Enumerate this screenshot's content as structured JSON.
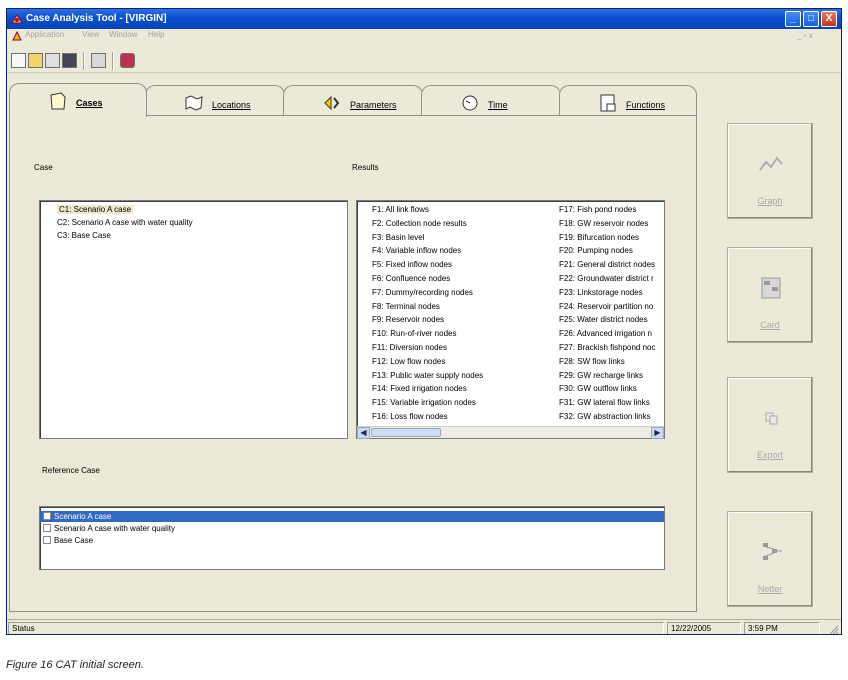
{
  "window": {
    "title": "Case Analysis Tool - [VIRGIN]",
    "minimize": "_",
    "maximize": "□",
    "close": "X",
    "mdi_controls": "_ ▫ x"
  },
  "menu": [
    "Application",
    "View",
    "Window",
    "Help"
  ],
  "toolbar": [
    "new-icon",
    "open-icon",
    "import-icon",
    "save-icon",
    "properties-icon",
    "book-icon"
  ],
  "tabs": [
    {
      "label": "Cases",
      "icon": "folder-icon"
    },
    {
      "label": "Locations",
      "icon": "map-icon"
    },
    {
      "label": "Parameters",
      "icon": "parameters-icon"
    },
    {
      "label": "Time",
      "icon": "clock-icon"
    },
    {
      "label": "Functions",
      "icon": "functions-icon"
    }
  ],
  "case": {
    "label": "Case",
    "items": [
      "C1: Scenario A case",
      "C2: Scenario A case with water quality",
      "C3: Base Case"
    ]
  },
  "results": {
    "label": "Results",
    "col1": [
      "F1: All link flows",
      "F2: Collection node results",
      "F3: Basin level",
      "F4: Variable inflow nodes",
      "F5: Fixed inflow nodes",
      "F6: Confluence nodes",
      "F7: Dummy/recording nodes",
      "F8: Terminal nodes",
      "F9: Reservoir nodes",
      "F10: Run-of-river nodes",
      "F11: Diversion nodes",
      "F12: Low flow nodes",
      "F13: Public water supply nodes",
      "F14: Fixed irrigation nodes",
      "F15: Variable irrigation nodes",
      "F16: Loss flow nodes"
    ],
    "col2": [
      "F17: Fish pond nodes",
      "F18: GW reservoir nodes",
      "F19: Bifurcation nodes",
      "F20: Pumping nodes",
      "F21: General district nodes",
      "F22: Groundwater district r",
      "F23: Linkstorage nodes",
      "F24: Reservoir partition no",
      "F25: Water district nodes",
      "F26: Advanced irrigation n",
      "F27: Brackish fishpond noc",
      "F28: SW flow links",
      "F29: GW recharge links",
      "F30: GW outflow links",
      "F31: GW lateral flow links",
      "F32: GW abstraction links"
    ]
  },
  "reference": {
    "label": "Reference Case",
    "items": [
      "Scenario A case",
      "Scenario A case with water quality",
      "Base Case"
    ]
  },
  "side_buttons": [
    {
      "label": "Graph",
      "icon": "graph-icon"
    },
    {
      "label": "Card",
      "icon": "card-icon"
    },
    {
      "label": "Export",
      "icon": "export-icon"
    },
    {
      "label": "Netter",
      "icon": "netter-icon"
    }
  ],
  "status": {
    "text": "Status",
    "date": "12/22/2005",
    "time": "3:59 PM"
  },
  "caption": "Figure 16 CAT initial screen."
}
